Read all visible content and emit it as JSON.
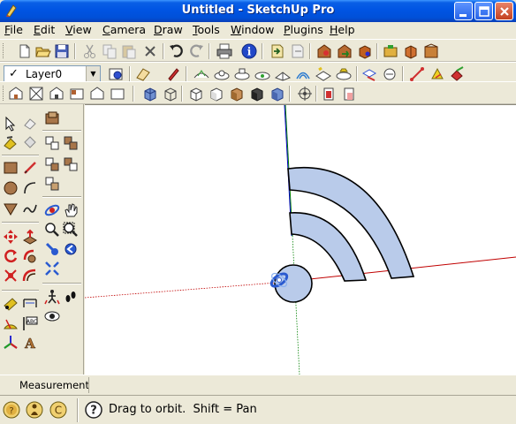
{
  "window": {
    "title": "Untitled - SketchUp Pro",
    "controls": [
      "minimize",
      "maximize",
      "close"
    ]
  },
  "menu": {
    "items": [
      {
        "label": "File",
        "mnemonic": "F"
      },
      {
        "label": "Edit",
        "mnemonic": "E"
      },
      {
        "label": "View",
        "mnemonic": "V"
      },
      {
        "label": "Camera",
        "mnemonic": "C"
      },
      {
        "label": "Draw",
        "mnemonic": "D"
      },
      {
        "label": "Tools",
        "mnemonic": "T"
      },
      {
        "label": "Window",
        "mnemonic": "W"
      },
      {
        "label": "Plugins",
        "mnemonic": "P"
      },
      {
        "label": "Help",
        "mnemonic": "H"
      }
    ]
  },
  "toolbar_standard": {
    "icons": [
      "new-icon",
      "open-icon",
      "save-icon",
      "cut-icon",
      "copy-icon",
      "paste-icon",
      "erase-icon",
      "undo-icon",
      "redo-icon",
      "print-icon",
      "model-info-icon",
      "import-icon",
      "export-icon",
      "warehouse-get-icon",
      "warehouse-share-icon",
      "component-icon",
      "extension-icon",
      "3d-icon",
      "warehouse-icon"
    ]
  },
  "layers": {
    "current": "Layer0",
    "checked": true
  },
  "toolbar_row2": {
    "icons": [
      "layer-manager-icon",
      "section-plane-icon",
      "paint-icon",
      "sandbox-smoove-icon",
      "sandbox-stamp-icon",
      "sandbox-drape-icon",
      "sandbox-add-detail-icon",
      "sandbox-flip-edge-icon",
      "sandbox-from-contours-icon",
      "sandbox-from-scratch-icon",
      "solid-union-icon",
      "solid-subtract-icon",
      "solid-trim-icon",
      "solid-split-icon",
      "solid-outer-shell-icon",
      "solid-intersect-icon"
    ]
  },
  "toolbar_row3": {
    "icons": [
      "view-iso-icon",
      "view-top-icon",
      "view-front-icon",
      "view-right-icon",
      "view-back-icon",
      "view-left-icon",
      "style-xray-icon",
      "style-wireframe-icon",
      "style-hidden-line-icon",
      "style-shaded-icon",
      "style-textured-icon",
      "style-monochrome-icon",
      "section-display-icon",
      "section-fill-icon",
      "section-cut-icon"
    ]
  },
  "left_toolbar": {
    "icons": [
      "select-icon",
      "eraser-icon",
      "make-component-icon",
      "paint-bucket-icon",
      "rectangle-icon",
      "line-icon",
      "circle-icon",
      "arc-icon",
      "polygon-icon",
      "freehand-icon",
      "move-icon",
      "push-pull-icon",
      "rotate-icon",
      "follow-me-icon",
      "scale-icon",
      "offset-icon",
      "tape-measure-icon",
      "dimension-icon",
      "protractor-icon",
      "text-icon",
      "axes-icon",
      "3d-text-icon",
      "orbit-icon",
      "pan-icon",
      "zoom-icon",
      "zoom-window-icon",
      "zoom-extents-icon",
      "previous-view-icon",
      "position-camera-icon",
      "walk-icon",
      "look-around-icon",
      "section-plane-icon"
    ]
  },
  "viewport": {
    "axis_colors": {
      "red": "#c00000",
      "green": "#008000",
      "blue": "#0000c0"
    },
    "face_color": "#b9cbea",
    "edge_color": "#000000",
    "cursor": "orbit-cursor-icon"
  },
  "measurements": {
    "label": "Measurements",
    "value": ""
  },
  "status": {
    "icons": [
      "geo-location-icon",
      "credits-icon",
      "user-icon"
    ],
    "help_icon": "help-icon",
    "text": "Drag to orbit.  Shift = Pan"
  }
}
